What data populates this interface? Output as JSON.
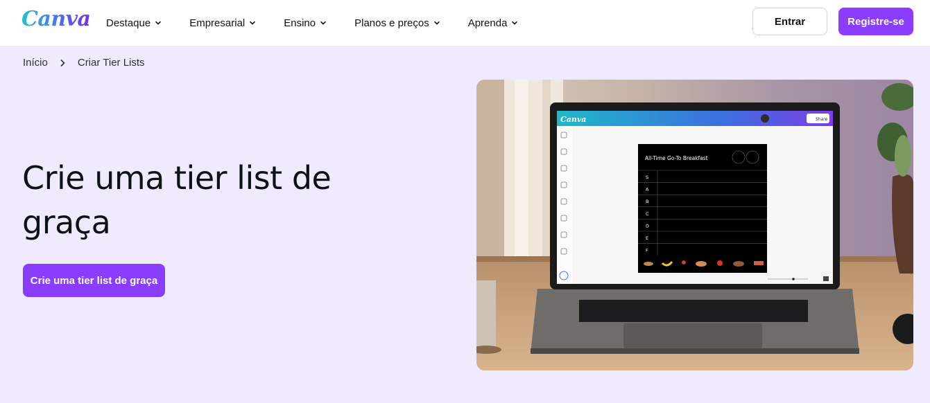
{
  "header": {
    "logo": "Canva",
    "nav": [
      {
        "label": "Destaque"
      },
      {
        "label": "Empresarial"
      },
      {
        "label": "Ensino"
      },
      {
        "label": "Planos e preços"
      },
      {
        "label": "Aprenda"
      }
    ],
    "login_label": "Entrar",
    "signup_label": "Registre-se"
  },
  "breadcrumb": {
    "home": "Início",
    "current": "Criar Tier Lists"
  },
  "hero": {
    "title": "Crie uma tier list de graça",
    "cta_label": "Crie uma tier list de graça"
  },
  "laptop_screen": {
    "app_logo": "Canva",
    "share_label": "Share",
    "design_title": "All-Time Go-To Breakfast",
    "tiers": [
      "S",
      "A",
      "B",
      "C",
      "D",
      "E",
      "F"
    ]
  },
  "colors": {
    "brand_purple": "#8b3dff",
    "hero_background": "#efeafd"
  }
}
